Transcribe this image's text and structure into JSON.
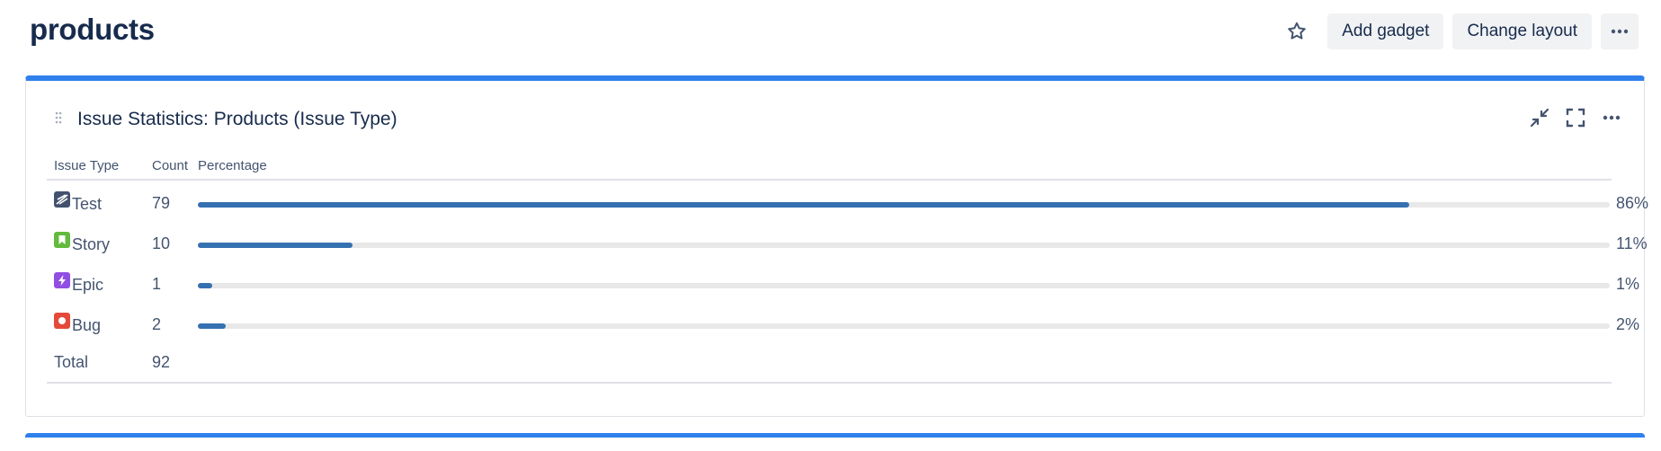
{
  "page": {
    "title": "products"
  },
  "header": {
    "star_icon": "star-outline-icon",
    "add_gadget_label": "Add gadget",
    "change_layout_label": "Change layout",
    "more_icon": "ellipsis-icon"
  },
  "gadget": {
    "title": "Issue Statistics: Products (Issue Type)",
    "icons": [
      "minimize-icon",
      "fullscreen-icon",
      "ellipsis-icon"
    ],
    "accent_color": "#2f80ed",
    "bar_color": "#3571b0",
    "columns": {
      "type": "Issue Type",
      "count": "Count",
      "percentage": "Percentage"
    },
    "rows": [
      {
        "type": "Test",
        "count": "79",
        "percentage": "86%",
        "fraction": 0.86,
        "icon": "test-issue-icon",
        "icon_color": "#42526e"
      },
      {
        "type": "Story",
        "count": "10",
        "percentage": "11%",
        "fraction": 0.11,
        "icon": "story-issue-icon",
        "icon_color": "#63ba3c"
      },
      {
        "type": "Epic",
        "count": "1",
        "percentage": "1%",
        "fraction": 0.01,
        "icon": "epic-issue-icon",
        "icon_color": "#904ee2"
      },
      {
        "type": "Bug",
        "count": "2",
        "percentage": "2%",
        "fraction": 0.02,
        "icon": "bug-issue-icon",
        "icon_color": "#e5493a"
      }
    ],
    "total": {
      "label": "Total",
      "count": "92"
    }
  }
}
